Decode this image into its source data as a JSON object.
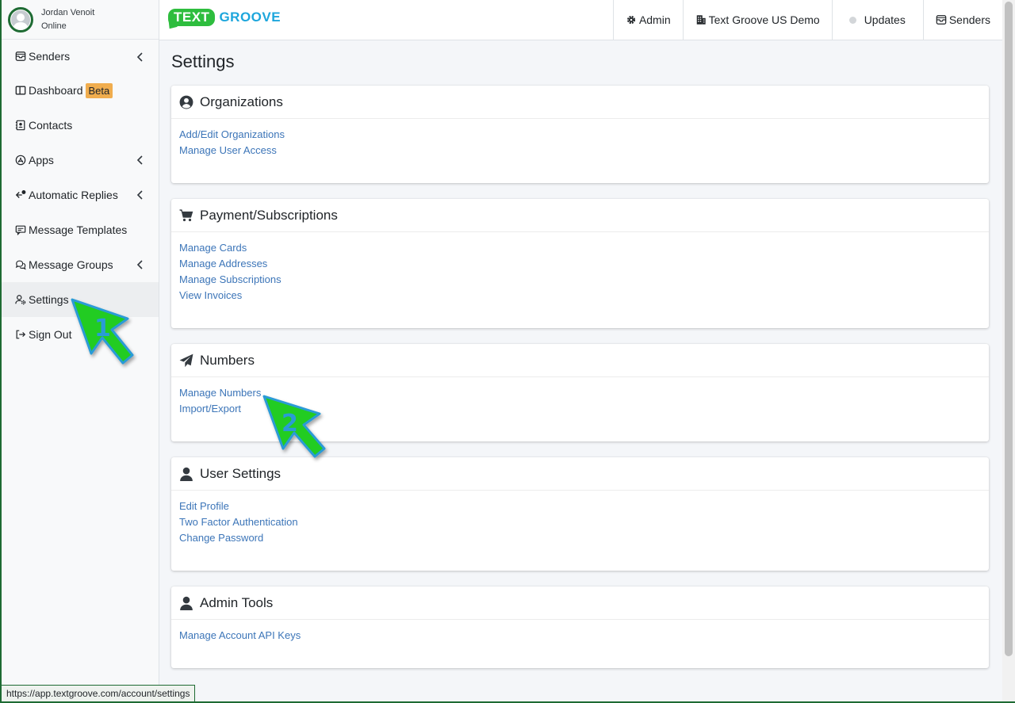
{
  "user": {
    "name": "Jordan Venoit",
    "status": "Online"
  },
  "logo": {
    "part1": "TEXT",
    "part2": "GROOVE"
  },
  "topnav": [
    {
      "icon": "gear-icon",
      "label": "Admin"
    },
    {
      "icon": "building-icon",
      "label": "Text Groove US Demo"
    },
    {
      "icon": "status-dot-icon",
      "label": "Updates"
    },
    {
      "icon": "inbox-icon",
      "label": "Senders"
    }
  ],
  "sidebar": {
    "items": [
      {
        "label": "Senders",
        "icon": "inbox-icon",
        "chevron": true
      },
      {
        "label": "Dashboard",
        "icon": "dashboard-icon",
        "badge": "Beta"
      },
      {
        "label": "Contacts",
        "icon": "contact-card-icon"
      },
      {
        "label": "Apps",
        "icon": "app-store-icon",
        "chevron": true
      },
      {
        "label": "Automatic Replies",
        "icon": "reply-icon",
        "chevron": true
      },
      {
        "label": "Message Templates",
        "icon": "template-icon"
      },
      {
        "label": "Message Groups",
        "icon": "chat-group-icon",
        "chevron": true
      },
      {
        "label": "Settings",
        "icon": "user-gear-icon",
        "active": true
      },
      {
        "label": "Sign Out",
        "icon": "sign-out-icon"
      }
    ]
  },
  "page": {
    "title": "Settings"
  },
  "sections": [
    {
      "title": "Organizations",
      "icon": "user-circle-icon",
      "links": [
        "Add/Edit Organizations",
        "Manage User Access"
      ]
    },
    {
      "title": "Payment/Subscriptions",
      "icon": "cart-icon",
      "links": [
        "Manage Cards",
        "Manage Addresses",
        "Manage Subscriptions",
        "View Invoices"
      ]
    },
    {
      "title": "Numbers",
      "icon": "paper-plane-icon",
      "links": [
        "Manage Numbers",
        "Import/Export"
      ]
    },
    {
      "title": "User Settings",
      "icon": "user-icon",
      "links": [
        "Edit Profile",
        "Two Factor Authentication",
        "Change Password"
      ]
    },
    {
      "title": "Admin Tools",
      "icon": "user-icon",
      "links": [
        "Manage Account API Keys"
      ]
    }
  ],
  "status_url": "https://app.textgroove.com/account/settings",
  "annotations": {
    "arrow1": "1",
    "arrow2": "2"
  },
  "colors": {
    "brand_green": "#2ebd3e",
    "brand_blue": "#1da6dc",
    "link": "#3c75b8",
    "badge": "#f0ad4e",
    "arrow_green": "#22cc22",
    "arrow_number": "#2a9bd6"
  }
}
